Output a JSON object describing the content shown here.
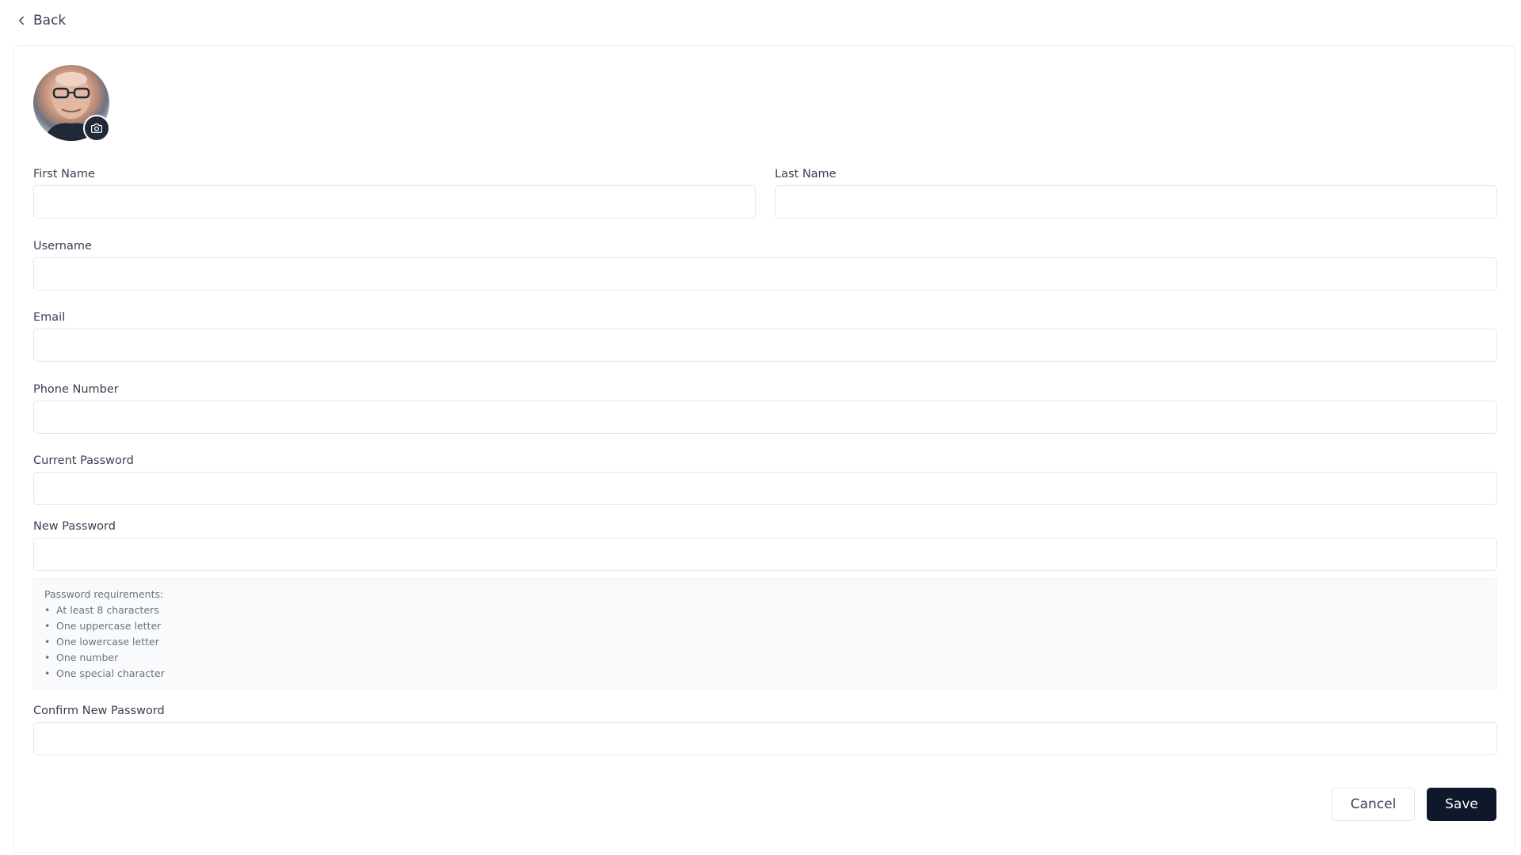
{
  "nav": {
    "back_label": "Back"
  },
  "profile": {
    "avatar_alt": "Profile photo"
  },
  "form": {
    "first_name": {
      "label": "First Name",
      "value": ""
    },
    "last_name": {
      "label": "Last Name",
      "value": ""
    },
    "username": {
      "label": "Username",
      "value": ""
    },
    "email": {
      "label": "Email",
      "value": ""
    },
    "phone": {
      "label": "Phone Number",
      "value": ""
    },
    "current_password": {
      "label": "Current Password",
      "value": ""
    },
    "new_password": {
      "label": "New Password",
      "value": ""
    },
    "confirm_password": {
      "label": "Confirm New Password",
      "value": ""
    }
  },
  "password_requirements": {
    "title": "Password requirements:",
    "items": [
      "At least 8 characters",
      "One uppercase letter",
      "One lowercase letter",
      "One number",
      "One special character"
    ]
  },
  "actions": {
    "cancel_label": "Cancel",
    "save_label": "Save"
  },
  "colors": {
    "primary": "#0f172a",
    "border": "#e5e7eb",
    "muted_bg": "#f9fafb"
  }
}
